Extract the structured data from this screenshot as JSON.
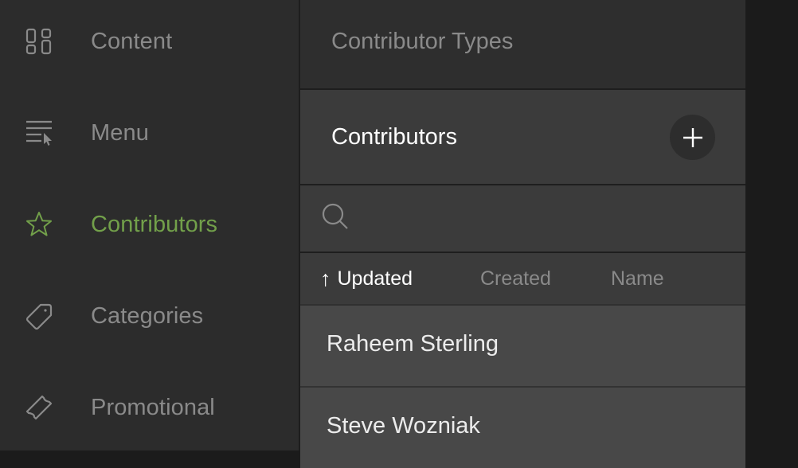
{
  "sidebar": {
    "active_color": "#72a04a",
    "items": [
      {
        "label": "Content",
        "icon": "grid-icon",
        "active": false
      },
      {
        "label": "Menu",
        "icon": "menu-cursor-icon",
        "active": false
      },
      {
        "label": "Contributors",
        "icon": "star-icon",
        "active": true
      },
      {
        "label": "Categories",
        "icon": "tag-icon",
        "active": false
      },
      {
        "label": "Promotional",
        "icon": "ticket-icon",
        "active": false
      }
    ]
  },
  "panel": {
    "types_title": "Contributor Types",
    "section_title": "Contributors",
    "add_button_icon": "plus-icon",
    "search": {
      "value": "",
      "placeholder": "",
      "icon": "search-icon"
    },
    "sort": {
      "options": [
        {
          "label": "Updated",
          "active": true,
          "direction": "↑"
        },
        {
          "label": "Created",
          "active": false
        },
        {
          "label": "Name",
          "active": false
        }
      ]
    },
    "contributors": [
      {
        "name": "Raheem Sterling"
      },
      {
        "name": "Steve Wozniak"
      }
    ]
  }
}
